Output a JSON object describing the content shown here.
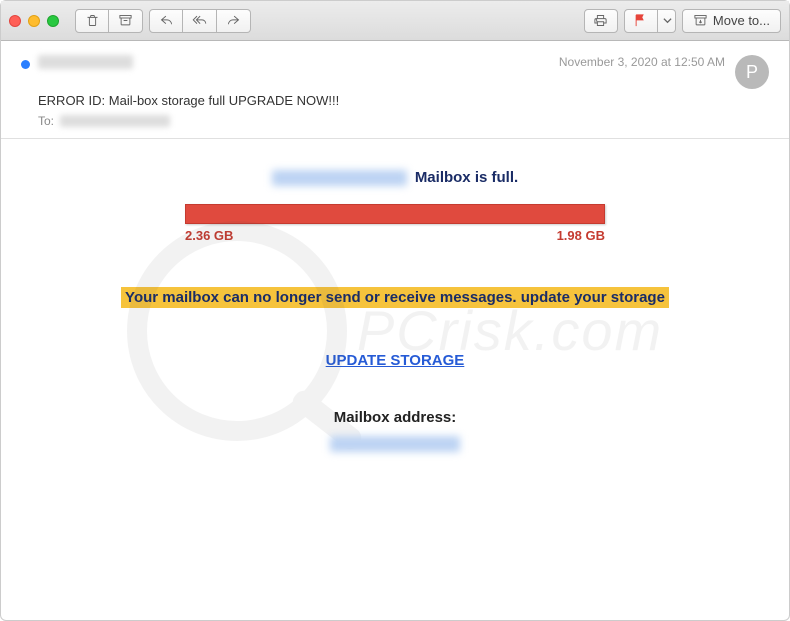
{
  "toolbar": {
    "move_label": "Move to..."
  },
  "header": {
    "date": "November 3, 2020 at 12:50 AM",
    "avatar_initial": "P",
    "subject": "ERROR ID: Mail-box storage full UPGRADE NOW!!!",
    "to_label": "To:"
  },
  "body": {
    "title_suffix": "Mailbox is full.",
    "bar_left": "2.36 GB",
    "bar_right": "1.98 GB",
    "banner": "Your mailbox can no longer send or receive messages. update your storage",
    "update_link": "UPDATE STORAGE",
    "address_label": "Mailbox address:"
  },
  "watermark": {
    "text": "PCrisk.com"
  }
}
